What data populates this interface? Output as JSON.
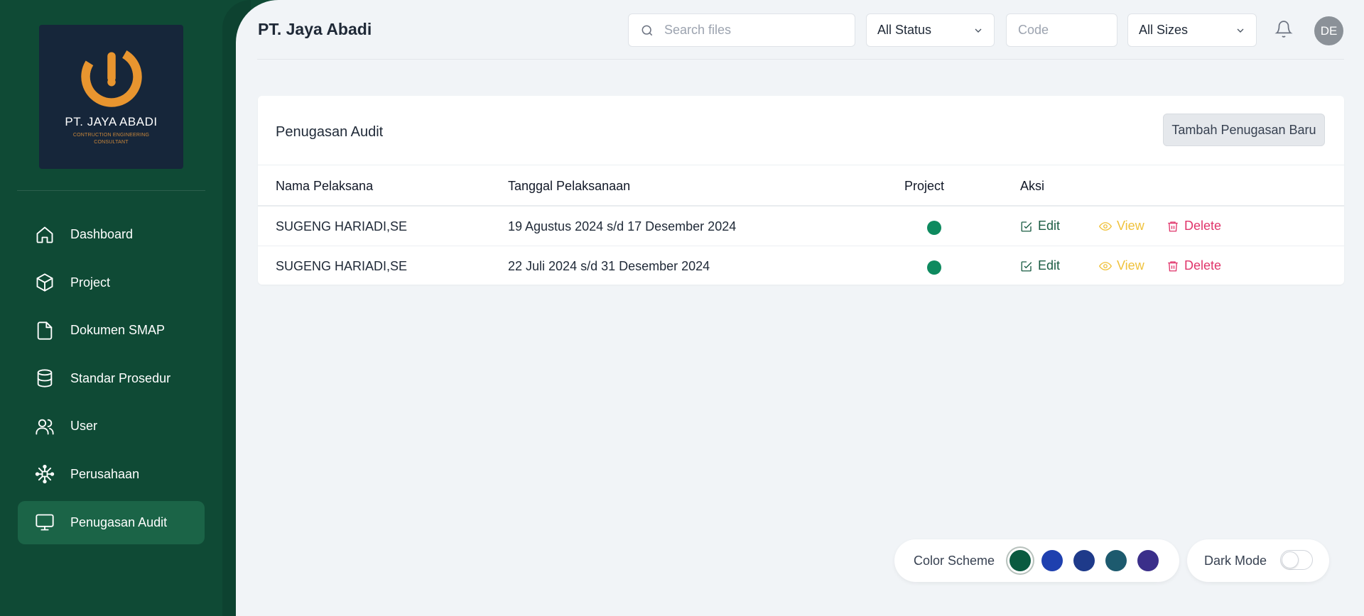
{
  "brand": {
    "logo_title": "PT. JAYA ABADI",
    "logo_subtitle": "CONTRUCTION ENGINEERING CONSULTANT",
    "logo_icon": "jaya-abadi-logo-icon"
  },
  "sidebar": {
    "items": [
      {
        "label": "Dashboard",
        "icon": "home-icon",
        "active": false
      },
      {
        "label": "Project",
        "icon": "cube-icon",
        "active": false
      },
      {
        "label": "Dokumen SMAP",
        "icon": "document-icon",
        "active": false
      },
      {
        "label": "Standar Prosedur",
        "icon": "database-icon",
        "active": false
      },
      {
        "label": "User",
        "icon": "users-icon",
        "active": false
      },
      {
        "label": "Perusahaan",
        "icon": "network-icon",
        "active": false
      },
      {
        "label": "Penugasan Audit",
        "icon": "monitor-icon",
        "active": true
      }
    ]
  },
  "header": {
    "title": "PT. Jaya Abadi",
    "search_placeholder": "Search files",
    "status_filter": "All Status",
    "code_placeholder": "Code",
    "size_filter": "All Sizes",
    "avatar_initials": "DE"
  },
  "card": {
    "title": "Penugasan Audit",
    "add_button": "Tambah Penugasan Baru",
    "columns": [
      "Nama Pelaksana",
      "Tanggal Pelaksanaan",
      "Project",
      "Aksi"
    ],
    "rows": [
      {
        "nama": "SUGENG HARIADI,SE",
        "tanggal": "19 Agustus 2024 s/d 17 Desember 2024",
        "project_color": "#0e8a5f"
      },
      {
        "nama": "SUGENG HARIADI,SE",
        "tanggal": "22 Juli 2024 s/d 31 Desember 2024",
        "project_color": "#0e8a5f"
      }
    ],
    "actions": {
      "edit": "Edit",
      "view": "View",
      "delete": "Delete"
    }
  },
  "theme": {
    "scheme_label": "Color Scheme",
    "dark_mode_label": "Dark Mode",
    "dark_mode_on": false,
    "swatches": [
      "#0a5a40",
      "#1e40af",
      "#1e3a8a",
      "#1d5a6e",
      "#3b2f8a"
    ],
    "selected_swatch": 0,
    "colors": {
      "sidebar": "#0f4a35",
      "accent": "#0e8a5f"
    }
  }
}
